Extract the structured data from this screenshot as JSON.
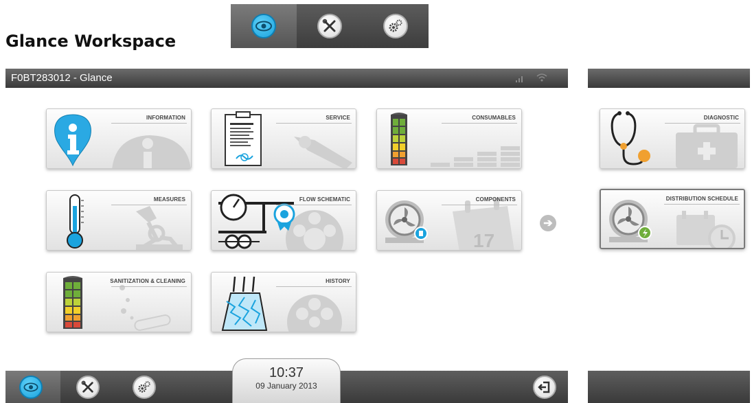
{
  "heading": "Glance Workspace",
  "window": {
    "title": "F0BT283012 - Glance",
    "icons": [
      "signal-icon",
      "wifi-icon"
    ]
  },
  "mode_strip": {
    "items": [
      {
        "name": "glance",
        "icon": "eye-icon",
        "active": true
      },
      {
        "name": "tools",
        "icon": "tools-icon",
        "active": false
      },
      {
        "name": "settings",
        "icon": "gears-icon",
        "active": false
      }
    ]
  },
  "tiles": [
    {
      "id": "information",
      "label": "INFORMATION",
      "icon": "info-icon"
    },
    {
      "id": "service",
      "label": "SERVICE",
      "icon": "clipboard-icon"
    },
    {
      "id": "consumables",
      "label": "CONSUMABLES",
      "icon": "cartridge-icon"
    },
    {
      "id": "measures",
      "label": "MEASURES",
      "icon": "thermometer-icon"
    },
    {
      "id": "flow_schematic",
      "label": "FLOW SCHEMATIC",
      "icon": "gauge-icon"
    },
    {
      "id": "components",
      "label": "COMPONENTS",
      "icon": "pump-icon"
    },
    {
      "id": "sanitization",
      "label": "SANITIZATION & CLEANING",
      "icon": "cartridge-icon"
    },
    {
      "id": "history",
      "label": "HISTORY",
      "icon": "film-reel-icon"
    }
  ],
  "right_tiles": [
    {
      "id": "diagnostic",
      "label": "DIAGNOSTIC",
      "icon": "stethoscope-icon"
    },
    {
      "id": "distribution_schedule",
      "label": "DISTRIBUTION SCHEDULE",
      "icon": "pump-schedule-icon",
      "selected": true
    }
  ],
  "clock": {
    "time": "10:37",
    "date": "09 January 2013"
  },
  "bottom_nav": {
    "items": [
      "eye-icon",
      "tools-icon",
      "gears-icon",
      "logout-icon"
    ]
  },
  "colors": {
    "accent_blue": "#1aa3de",
    "bar_dark": "#3a3a3a",
    "level_green": "#6fae3a",
    "level_yellow": "#f2cf2a",
    "level_red": "#d94a3a"
  }
}
